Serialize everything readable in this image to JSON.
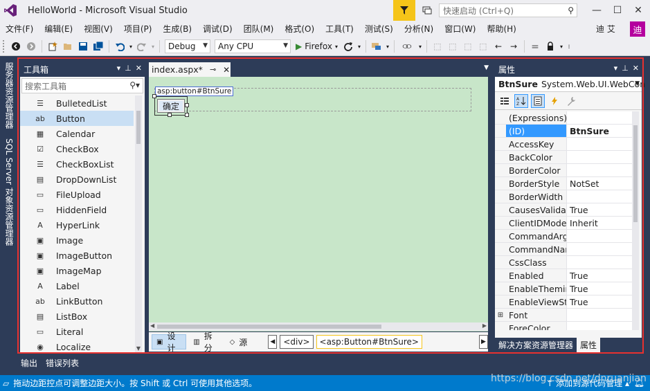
{
  "window": {
    "title": "HelloWorld - Microsoft Visual Studio",
    "quick_launch_placeholder": "快速启动 (Ctrl+Q)",
    "minimize": "—",
    "maximize": "☐",
    "close": "✕"
  },
  "menu": {
    "items": [
      "文件(F)",
      "编辑(E)",
      "视图(V)",
      "项目(P)",
      "生成(B)",
      "调试(D)",
      "团队(M)",
      "格式(O)",
      "工具(T)",
      "测试(S)",
      "分析(N)",
      "窗口(W)",
      "帮助(H)"
    ],
    "user_name": "迪 艾",
    "user_avatar": "迪"
  },
  "toolbar": {
    "configuration": "Debug",
    "platform": "Any CPU",
    "run_target": "Firefox"
  },
  "left_vertical_tabs": [
    "服务器资源管理器",
    "SQL Server 对象资源管理器"
  ],
  "toolbox": {
    "title": "工具箱",
    "search_placeholder": "搜索工具箱",
    "items": [
      {
        "label": "BulletedList",
        "icon": "☰"
      },
      {
        "label": "Button",
        "icon": "ab"
      },
      {
        "label": "Calendar",
        "icon": "▦"
      },
      {
        "label": "CheckBox",
        "icon": "☑"
      },
      {
        "label": "CheckBoxList",
        "icon": "☰"
      },
      {
        "label": "DropDownList",
        "icon": "▤"
      },
      {
        "label": "FileUpload",
        "icon": "▭"
      },
      {
        "label": "HiddenField",
        "icon": "▭"
      },
      {
        "label": "HyperLink",
        "icon": "A"
      },
      {
        "label": "Image",
        "icon": "▣"
      },
      {
        "label": "ImageButton",
        "icon": "▣"
      },
      {
        "label": "ImageMap",
        "icon": "▣"
      },
      {
        "label": "Label",
        "icon": "A"
      },
      {
        "label": "LinkButton",
        "icon": "ab"
      },
      {
        "label": "ListBox",
        "icon": "▤"
      },
      {
        "label": "Literal",
        "icon": "▭"
      },
      {
        "label": "Localize",
        "icon": "◉"
      }
    ],
    "selected_index": 1
  },
  "editor": {
    "tab_label": "index.aspx*",
    "asp_badge": "asp:button#BtnSure",
    "button_text": "确定",
    "views": [
      {
        "label": "设计",
        "icon": "▣"
      },
      {
        "label": "拆分",
        "icon": "▥"
      },
      {
        "label": "源",
        "icon": "◇"
      }
    ],
    "breadcrumbs": [
      "<div>",
      "<asp:Button#BtnSure>"
    ]
  },
  "properties": {
    "title": "属性",
    "object_name": "BtnSure",
    "object_type": "System.Web.UI.WebCon",
    "rows": [
      {
        "name": "(Expressions)",
        "value": "",
        "expand": ""
      },
      {
        "name": "(ID)",
        "value": "BtnSure",
        "expand": ""
      },
      {
        "name": "AccessKey",
        "value": "",
        "expand": ""
      },
      {
        "name": "BackColor",
        "value": "",
        "expand": ""
      },
      {
        "name": "BorderColor",
        "value": "",
        "expand": ""
      },
      {
        "name": "BorderStyle",
        "value": "NotSet",
        "expand": ""
      },
      {
        "name": "BorderWidth",
        "value": "",
        "expand": ""
      },
      {
        "name": "CausesValidati",
        "value": "True",
        "expand": ""
      },
      {
        "name": "ClientIDMode",
        "value": "Inherit",
        "expand": ""
      },
      {
        "name": "CommandArgu",
        "value": "",
        "expand": ""
      },
      {
        "name": "CommandNan",
        "value": "",
        "expand": ""
      },
      {
        "name": "CssClass",
        "value": "",
        "expand": ""
      },
      {
        "name": "Enabled",
        "value": "True",
        "expand": ""
      },
      {
        "name": "EnableThemin",
        "value": "True",
        "expand": ""
      },
      {
        "name": "EnableViewSta",
        "value": "True",
        "expand": ""
      },
      {
        "name": "Font",
        "value": "",
        "expand": "⊞"
      },
      {
        "name": "ForeColor",
        "value": "",
        "expand": ""
      }
    ],
    "selected_index": 1,
    "bottom_tabs": [
      "解决方案资源管理器",
      "属性"
    ]
  },
  "output_tabs": [
    "输出",
    "错误列表"
  ],
  "statusbar": {
    "message": "拖动边距控点可调整边距大小。按 Shift 或 Ctrl 可使用其他选项。",
    "source_control": "↑ 添加到源代码管理 ▴"
  },
  "watermark": "https://blog.csdn.net/dnruanjian",
  "colors": {
    "accent": "#007acc",
    "selection": "#3399ff",
    "highlight": "#e8312f",
    "design_surface": "#c8e6c9",
    "avatar": "#b4009e"
  }
}
